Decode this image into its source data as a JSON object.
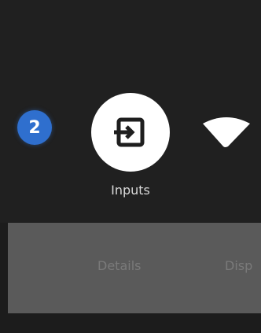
{
  "main": {
    "badge_count": "2",
    "inputs_label": "Inputs"
  },
  "tabs": {
    "details": "Details",
    "display": "Disp"
  },
  "icons": {
    "inputs": "input-source-icon",
    "network": "wifi-icon"
  },
  "colors": {
    "background": "#202020",
    "badge": "#2f6fce",
    "bottom_bar": "#5a5a5a"
  }
}
